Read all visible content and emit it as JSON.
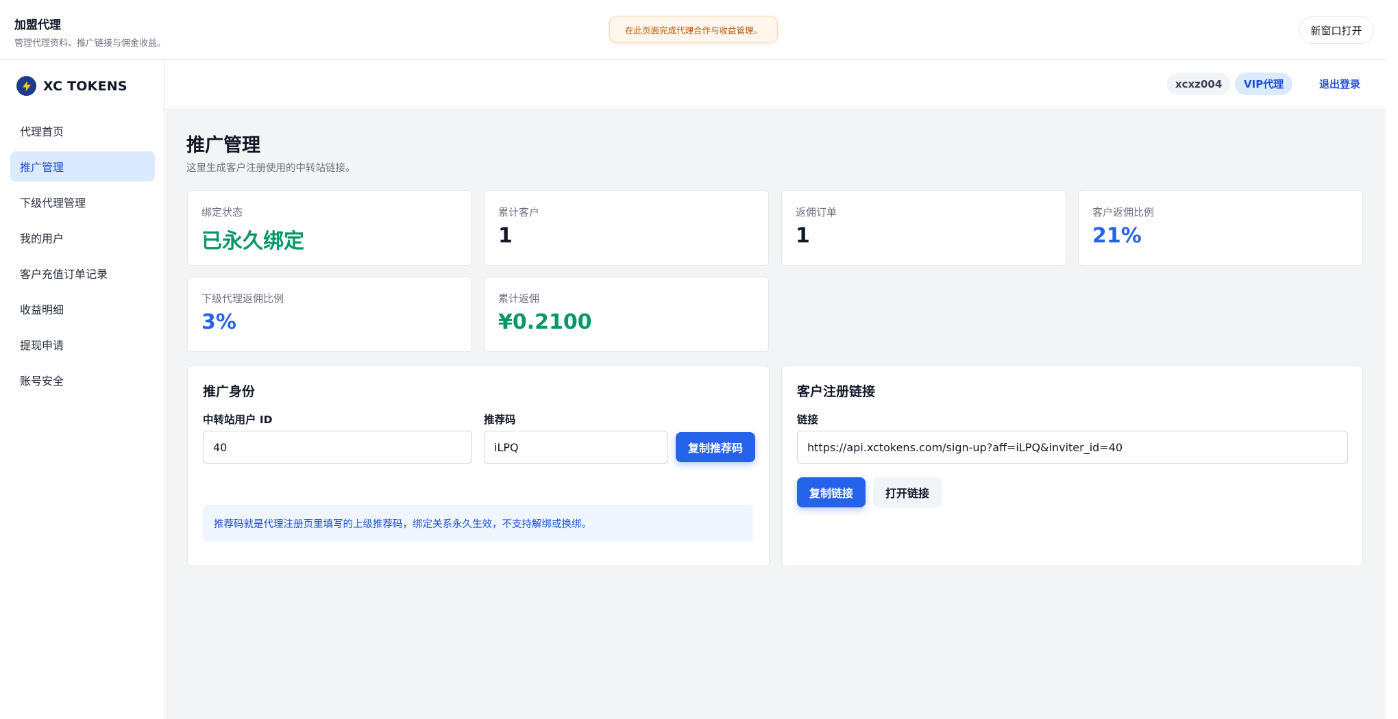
{
  "header": {
    "title": "加盟代理",
    "subtitle": "管理代理资料、推广链接与佣金收益。",
    "notice": "在此页面完成代理合作与收益管理。",
    "new_window_label": "新窗口打开"
  },
  "brand": {
    "name": "XC TOKENS",
    "icon": "lightning-icon"
  },
  "sidebar": {
    "items": [
      {
        "label": "代理首页",
        "active": false
      },
      {
        "label": "推广管理",
        "active": true
      },
      {
        "label": "下级代理管理",
        "active": false
      },
      {
        "label": "我的用户",
        "active": false
      },
      {
        "label": "客户充值订单记录",
        "active": false
      },
      {
        "label": "收益明细",
        "active": false
      },
      {
        "label": "提现申请",
        "active": false
      },
      {
        "label": "账号安全",
        "active": false
      }
    ]
  },
  "topbar": {
    "username": "xcxz004",
    "role": "VIP代理",
    "logout_label": "退出登录"
  },
  "page": {
    "title": "推广管理",
    "subtitle": "这里生成客户注册使用的中转站链接。"
  },
  "stats": [
    {
      "label": "绑定状态",
      "value": "已永久绑定"
    },
    {
      "label": "累计客户",
      "value": "1"
    },
    {
      "label": "返佣订单",
      "value": "1"
    },
    {
      "label": "客户返佣比例",
      "value": "21%"
    },
    {
      "label": "下级代理返佣比例",
      "value": "3%"
    },
    {
      "label": "累计返佣",
      "value": "¥0.2100"
    }
  ],
  "identity_panel": {
    "title": "推广身份",
    "user_id_label": "中转站用户 ID",
    "user_id_value": "40",
    "code_label": "推荐码",
    "code_value": "iLPQ",
    "copy_code_label": "复制推荐码",
    "hint": "推荐码就是代理注册页里填写的上级推荐码，绑定关系永久生效，不支持解绑或换绑。"
  },
  "link_panel": {
    "title": "客户注册链接",
    "link_label": "链接",
    "link_value": "https://api.xctokens.com/sign-up?aff=iLPQ&inviter_id=40",
    "copy_link_label": "复制链接",
    "open_link_label": "打开链接"
  },
  "colors": {
    "accent": "#2563eb",
    "success": "#059669",
    "active_bg": "#dbeafe",
    "notice_bg": "#fff7ed"
  }
}
